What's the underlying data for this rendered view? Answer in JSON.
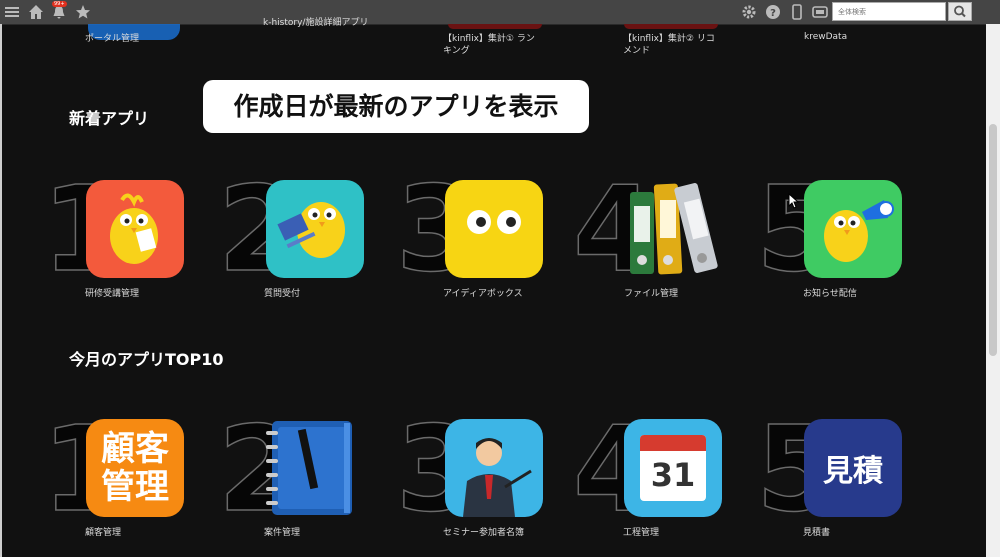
{
  "header": {
    "badge": "99+",
    "search_placeholder": "全体検索"
  },
  "prev_row": [
    {
      "label": "ポータル管理"
    },
    {
      "label": "k-history/施設詳細アプリ"
    },
    {
      "label": "【kinflix】集計① ランキング"
    },
    {
      "label": "【kinflix】集計② リコメンド"
    },
    {
      "label": "krewData"
    }
  ],
  "callout": "作成日が最新のアプリを表示",
  "new_apps": {
    "title": "新着アプリ",
    "items": [
      {
        "rank": "1",
        "label": "研修受講管理",
        "color": "#f35a3c"
      },
      {
        "rank": "2",
        "label": "質問受付",
        "color": "#2fc1c6"
      },
      {
        "rank": "3",
        "label": "アイディアボックス",
        "color": "#f7d513"
      },
      {
        "rank": "4",
        "label": "ファイル管理",
        "color": "#8c8c8c"
      },
      {
        "rank": "5",
        "label": "お知らせ配信",
        "color": "#3fcb63"
      }
    ]
  },
  "top_apps": {
    "title": "今月のアプリTOP10",
    "items": [
      {
        "rank": "1",
        "label": "顧客管理",
        "icon_text": "顧客管理",
        "color": "#f68a12"
      },
      {
        "rank": "2",
        "label": "案件管理",
        "color": "#1f5fb4"
      },
      {
        "rank": "3",
        "label": "セミナー参加者名簿",
        "color": "#3db5e6"
      },
      {
        "rank": "4",
        "label": "工程管理",
        "icon_text": "31",
        "color": "#3db5e6"
      },
      {
        "rank": "5",
        "label": "見積書",
        "icon_text": "見積",
        "color": "#273a8c"
      }
    ]
  }
}
